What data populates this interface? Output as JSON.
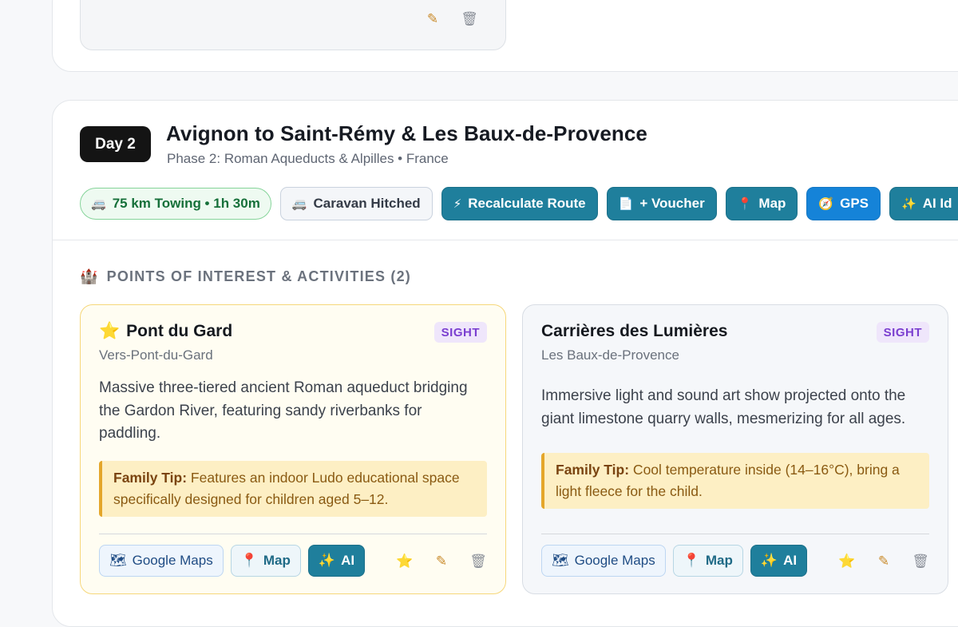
{
  "prev_card": {
    "edit_icon": "pencil-icon",
    "delete_icon": "trash-icon"
  },
  "day": {
    "badge": "Day 2",
    "title": "Avignon to Saint-Rémy & Les Baux-de-Provence",
    "subtitle": "Phase 2: Roman Aqueducts & Alpilles • France",
    "chips": {
      "towing": {
        "icon": "caravan-icon",
        "label": "75 km Towing • 1h 30m"
      },
      "caravan": {
        "icon": "caravan-icon",
        "label": "Caravan Hitched"
      },
      "recalc": {
        "icon": "lightning-icon",
        "label": "Recalculate Route"
      },
      "voucher": {
        "icon": "document-icon",
        "label": "+ Voucher"
      },
      "map": {
        "icon": "pin-icon",
        "label": "Map"
      },
      "gps": {
        "icon": "compass-icon",
        "label": "GPS"
      },
      "ai": {
        "icon": "sparkle-icon",
        "label": "AI Id"
      }
    }
  },
  "section": {
    "icon": "castle-icon",
    "title": "POINTS OF INTEREST & ACTIVITIES (2)"
  },
  "pois": [
    {
      "favorite": true,
      "name": "Pont du Gard",
      "tag": "SIGHT",
      "place": "Vers-Pont-du-Gard",
      "description": "Massive three-tiered ancient Roman aqueduct bridging the Gardon River, featuring sandy riverbanks for paddling.",
      "tip_label": "Family Tip:",
      "tip_text": " Features an indoor Ludo educational space specifically designed for children aged 5–12.",
      "buttons": {
        "gmaps": "Google Maps",
        "map": "Map",
        "ai": "AI"
      }
    },
    {
      "favorite": false,
      "name": "Carrières des Lumières",
      "tag": "SIGHT",
      "place": "Les Baux-de-Provence",
      "description": "Immersive light and sound art show projected onto the giant limestone quarry walls, mesmerizing for all ages.",
      "tip_label": "Family Tip:",
      "tip_text": " Cool temperature inside (14–16°C), bring a light fleece for the child.",
      "buttons": {
        "gmaps": "Google Maps",
        "map": "Map",
        "ai": "AI"
      }
    }
  ],
  "colors": {
    "accent_teal": "#1f7f9c",
    "accent_blue": "#1583d8",
    "tag_purple": "#7b3fd0",
    "tip_bg": "#fdefc4"
  }
}
